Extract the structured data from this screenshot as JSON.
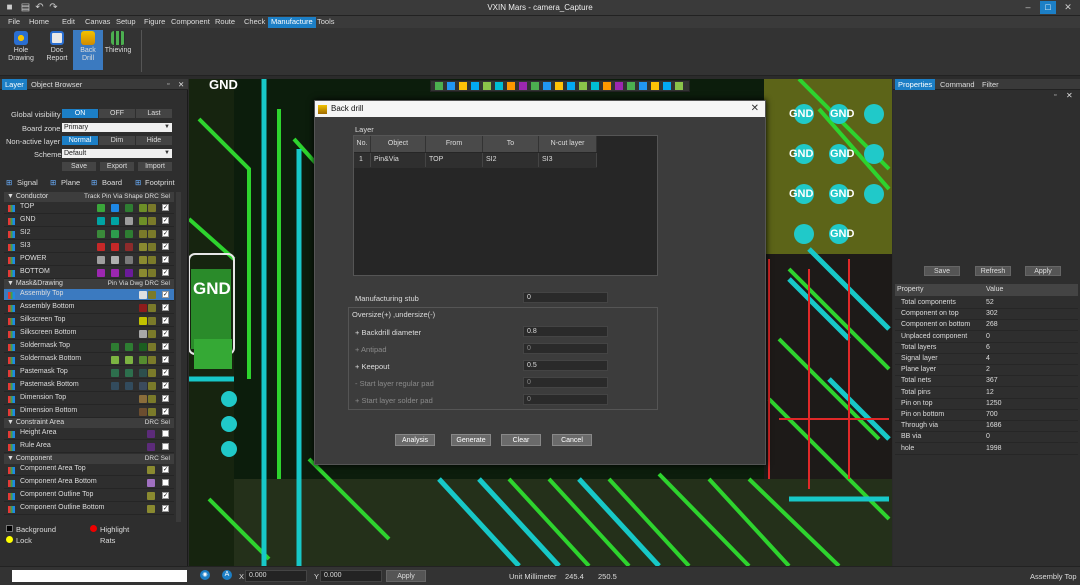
{
  "window": {
    "title": "VXIN Mars - camera_Capture"
  },
  "menu": [
    "File",
    "Home",
    "Edit",
    "Canvas",
    "Setup",
    "Figure",
    "Component",
    "Route",
    "Check",
    "Manufacture",
    "Tools"
  ],
  "ribbon": {
    "buttons": [
      "Hole\nDrawing",
      "Doc\nReport",
      "Back\nDrill",
      "Thieving"
    ]
  },
  "left_panel": {
    "tabs": [
      "Layer",
      "Object Browser"
    ],
    "global_visibility": {
      "label": "Global visibility",
      "options": [
        "ON",
        "OFF",
        "Last"
      ],
      "selected": "ON"
    },
    "board_zone": {
      "label": "Board zone",
      "value": "Primary"
    },
    "non_active_layer": {
      "label": "Non-active layer",
      "options": [
        "Normal",
        "Dim",
        "Hide"
      ],
      "selected": "Normal"
    },
    "scheme": {
      "label": "Scheme",
      "value": "Default"
    },
    "scheme_buttons": [
      "Save",
      "Export",
      "Import"
    ],
    "categories": [
      "Signal",
      "Plane",
      "Board",
      "Footprint"
    ],
    "conductor": {
      "title": "Conductor",
      "cols": "Track Pin  Via Shape DRC Sel",
      "layers": [
        "TOP",
        "GND",
        "SI2",
        "SI3",
        "POWER",
        "BOTTOM"
      ]
    },
    "mask": {
      "title": "Mask&Drawing",
      "cols": "Pin  Via  Dwg DRC Sel",
      "layers": [
        "Assembly Top",
        "Assembly Bottom",
        "Silkscreen Top",
        "Silkscreen Bottom",
        "Soldermask Top",
        "Soldermask Bottom",
        "Pastemask Top",
        "Pastemask Bottom",
        "Dimension Top",
        "Dimension Bottom"
      ]
    },
    "constraint": {
      "title": "Constraint Area",
      "cols": "DRC Sel",
      "layers": [
        "Height Area",
        "Rule Area"
      ]
    },
    "component": {
      "title": "Component",
      "cols": "DRC Sel",
      "layers": [
        "Component Area Top",
        "Component Area Bottom",
        "Component Outline Top",
        "Component Outline Bottom"
      ]
    },
    "legend": [
      "Background",
      "Highlight",
      "Lock",
      "Rats"
    ]
  },
  "dialog": {
    "title": "Back drill",
    "layer_label": "Layer",
    "columns": [
      "No.",
      "Object",
      "From",
      "To",
      "N-cut layer"
    ],
    "rows": [
      [
        "1",
        "Pin&Via",
        "TOP",
        "SI2",
        "SI3"
      ]
    ],
    "manufacturing_stub": {
      "label": "Manufacturing stub",
      "value": "0"
    },
    "oversize_label": "Oversize(+) ,undersize(-)",
    "fields": [
      {
        "label": "+ Backdrill diameter",
        "value": "0.8"
      },
      {
        "label": "+ Antipad",
        "value": "0"
      },
      {
        "label": "+ Keepout",
        "value": "0.5"
      },
      {
        "label": "- Start layer regular pad",
        "value": "0"
      },
      {
        "label": "+ Start layer solder pad",
        "value": "0"
      }
    ],
    "buttons": [
      "Analysis",
      "Generate",
      "Clear",
      "Cancel"
    ]
  },
  "right_panel": {
    "tabs": [
      "Properties",
      "Command",
      "Filter"
    ],
    "buttons": [
      "Save",
      "Refresh",
      "Apply"
    ],
    "headers": [
      "Property",
      "Value"
    ],
    "rows": [
      [
        "Total components",
        "52"
      ],
      [
        "Component on top",
        "302"
      ],
      [
        "Component on bottom",
        "268"
      ],
      [
        "Unplaced component",
        "0"
      ],
      [
        "Total layers",
        "6"
      ],
      [
        "Signal layer",
        "4"
      ],
      [
        "Plane layer",
        "2"
      ],
      [
        "Total nets",
        "367"
      ],
      [
        "Total pins",
        "12"
      ],
      [
        "Pin on top",
        "1250"
      ],
      [
        "Pin on bottom",
        "700"
      ],
      [
        "Through via",
        "1686"
      ],
      [
        "BB via",
        "0"
      ],
      [
        "hole",
        "1998"
      ]
    ]
  },
  "canvas": {
    "labels": [
      "GND",
      "GND",
      "GND",
      "GND",
      "GND",
      "GND",
      "GND",
      "GND",
      "GND"
    ]
  },
  "status": {
    "x_label": "X",
    "x_value": "0.000",
    "y_label": "Y",
    "y_value": "0.000",
    "apply": "Apply",
    "unit": "Unit Millimeter",
    "coord1": "245.4",
    "coord2": "250.5",
    "layer": "Assembly Top"
  }
}
